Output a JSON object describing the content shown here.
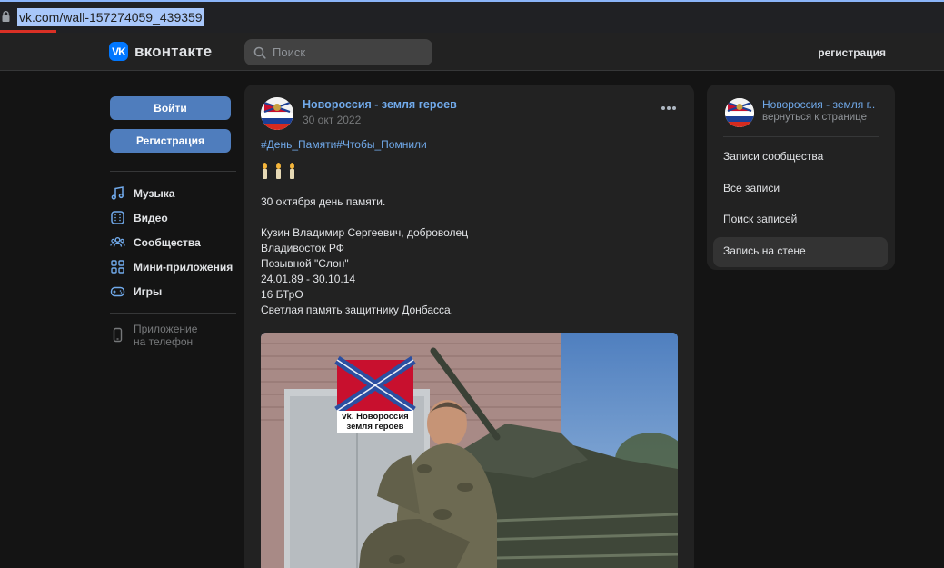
{
  "browser": {
    "url": "vk.com/wall-157274059_439359"
  },
  "header": {
    "logo_mark": "VK",
    "logo_text": "вконтакте",
    "search_placeholder": "Поиск",
    "register_label": "регистрация"
  },
  "leftnav": {
    "login_label": "Войти",
    "signup_label": "Регистрация",
    "items": [
      {
        "label": "Музыка",
        "icon": "music-icon"
      },
      {
        "label": "Видео",
        "icon": "video-icon"
      },
      {
        "label": "Сообщества",
        "icon": "communities-icon"
      },
      {
        "label": "Мини-приложения",
        "icon": "mini-apps-icon"
      },
      {
        "label": "Игры",
        "icon": "gamepad-icon"
      }
    ],
    "app_line1": "Приложение",
    "app_line2": "на телефон"
  },
  "post": {
    "author": "Новороссия - земля героев",
    "date": "30 окт 2022",
    "hashtags": "#День_Памяти#Чтобы_Помнили",
    "line_date": "30 октября день памяти.",
    "lines": [
      "Кузин Владимир Сергеевич, доброволец",
      "Владивосток РФ",
      "Позывной \"Слон\"",
      "24.01.89 - 30.10.14",
      "16 БТрО",
      "Светлая память защитнику Донбасса."
    ],
    "watermark_line1": "vk. Новороссия",
    "watermark_line2": "земля героев"
  },
  "rightpanel": {
    "title": "Новороссия - земля г...",
    "subtitle": "вернуться к странице",
    "items": [
      {
        "label": "Записи сообщества",
        "active": false
      },
      {
        "label": "Все записи",
        "active": false
      },
      {
        "label": "Поиск записей",
        "active": false
      },
      {
        "label": "Запись на стене",
        "active": true
      }
    ]
  },
  "colors": {
    "accent": "#4f7dbd",
    "link": "#71aaeb",
    "background": "#141414",
    "card": "#222222"
  }
}
